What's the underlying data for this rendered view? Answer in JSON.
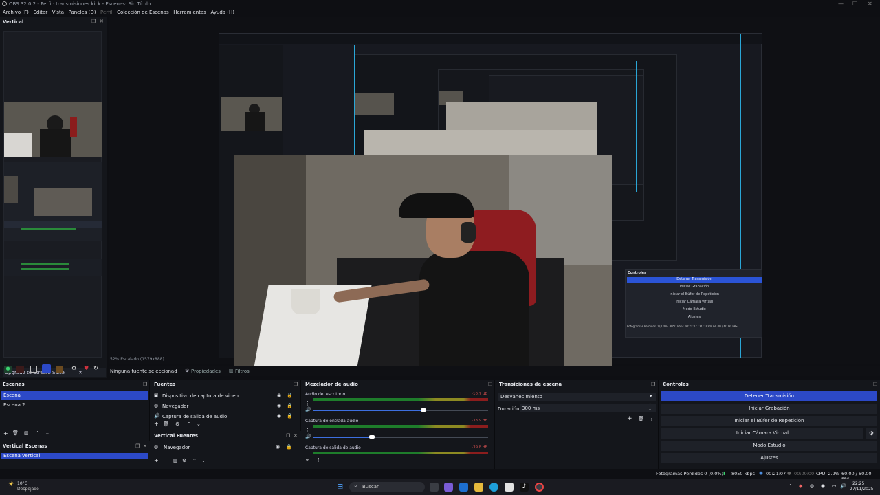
{
  "window": {
    "title": "OBS 32.0.2 - Perfil: transmisiones kick - Escenas: Sin Título",
    "min": "—",
    "max": "☐",
    "close": "✕"
  },
  "menu": [
    "Archivo (F)",
    "Editar",
    "Vista",
    "Paneles (D)",
    "Perfil",
    "Colección de Escenas",
    "Herramientas",
    "Ayuda (H)"
  ],
  "left_dock": {
    "title": "Vertical",
    "upgrade": "Upgrade to Stream Suite",
    "upgrade_close": "✕"
  },
  "preview": {
    "scale_text": "52%   Escalado (1579x888)",
    "no_source": "Ninguna fuente seleccionad",
    "properties": "Propiedades",
    "filters": "Filtros"
  },
  "nested_controls": {
    "title": "Controles",
    "buttons": [
      "Detener Transmisión",
      "Iniciar Grabación",
      "Iniciar el Búfer de Repetición",
      "Iniciar Cámara Virtual",
      "Modo Estudio",
      "Ajustes"
    ],
    "status": "Fotogramas Perdidos 0 (0.0%)   8050 kbps   00:21:07   CPU: 2.9%   60.00 / 60.00 FPS"
  },
  "scenes": {
    "title": "Escenas",
    "items": [
      "Escena",
      "Escena 2"
    ],
    "selected": 0
  },
  "vertical_scenes": {
    "title": "Vertical Escenas",
    "items": [
      "Escena vertical"
    ]
  },
  "sources": {
    "title": "Fuentes",
    "items": [
      "Dispositivo de captura de video",
      "Navegador",
      "Captura de salida de audio"
    ]
  },
  "vertical_sources": {
    "title": "Vertical Fuentes",
    "items": [
      "Navegador"
    ]
  },
  "mixer": {
    "title": "Mezclador de audio",
    "channels": [
      {
        "name": "Audio del escritorio",
        "db": "-10.7 dB",
        "level": 0.62
      },
      {
        "name": "Captura de entrada audio",
        "db": "-33.9 dB",
        "level": 0.35
      },
      {
        "name": "Captura de salida de audio",
        "db": "-39.8 dB",
        "level": 0
      }
    ],
    "ticks": [
      "-60",
      "-55",
      "-50",
      "-45",
      "-40",
      "-35",
      "-30",
      "-25",
      "-20",
      "-15",
      "-10",
      "-5",
      "0"
    ]
  },
  "transitions": {
    "title": "Transiciones de escena",
    "selected": "Desvanecimiento",
    "duration_label": "Duración",
    "duration_value": "300 ms"
  },
  "controls": {
    "title": "Controles",
    "buttons": [
      "Detener Transmisión",
      "Iniciar Grabación",
      "Iniciar el Búfer de Repetición",
      "Iniciar Cámara Virtual",
      "Modo Estudio",
      "Ajustes"
    ]
  },
  "status": {
    "dropped": "Fotogramas Perdidos 0 (0.0%)",
    "bitrate": "8050 kbps",
    "stream_time": "00:21:07",
    "rec_time": "00:00:00",
    "cpu": "CPU: 2.9%",
    "fps": "60.00 / 60.00 FPS"
  },
  "taskbar": {
    "weather_temp": "10°C",
    "weather_desc": "Despejado",
    "search": "Buscar",
    "time": "22:25",
    "date": "27/11/2025"
  },
  "colors": {
    "accent": "#2c49c7",
    "guide": "#2aa6d6",
    "live": "#2b54d6"
  }
}
